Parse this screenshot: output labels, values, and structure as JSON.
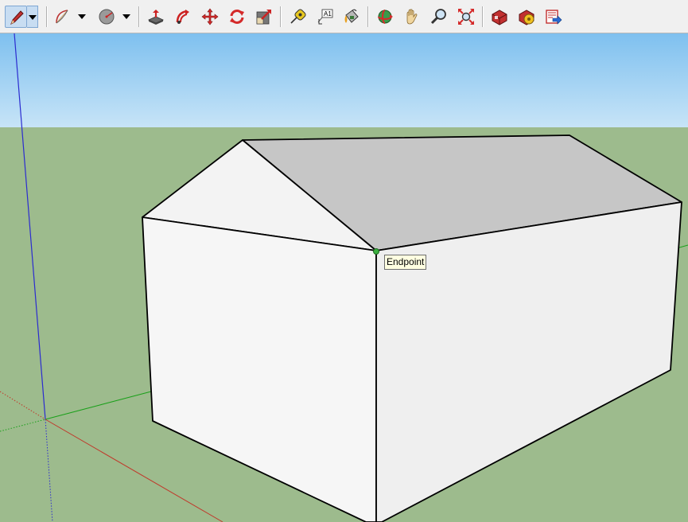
{
  "toolbar": {
    "tools": [
      {
        "name": "pencil-icon",
        "active": true,
        "dropdown": true
      },
      {
        "name": "arc-icon",
        "dropdown": true
      },
      {
        "name": "circle-icon",
        "dropdown": true
      },
      {
        "name": "push-pull-icon"
      },
      {
        "name": "follow-me-icon"
      },
      {
        "name": "move-icon"
      },
      {
        "name": "rotate-icon"
      },
      {
        "name": "scale-icon"
      },
      {
        "name": "tape-measure-icon"
      },
      {
        "name": "text-icon",
        "glyph": "A1"
      },
      {
        "name": "paint-bucket-icon"
      },
      {
        "name": "orbit-icon"
      },
      {
        "name": "pan-icon"
      },
      {
        "name": "zoom-icon"
      },
      {
        "name": "zoom-extents-icon"
      },
      {
        "name": "3d-warehouse-icon"
      },
      {
        "name": "extension-warehouse-icon"
      },
      {
        "name": "layout-icon"
      }
    ]
  },
  "viewport": {
    "sky_color": "#a9d4f3",
    "ground_color": "#9dbb8d",
    "inference_tooltip": "Endpoint",
    "inference_point_color": "#3cb040"
  },
  "axes": {
    "red": "#c0392b",
    "green": "#1aa01a",
    "blue": "#2b2bd0"
  }
}
